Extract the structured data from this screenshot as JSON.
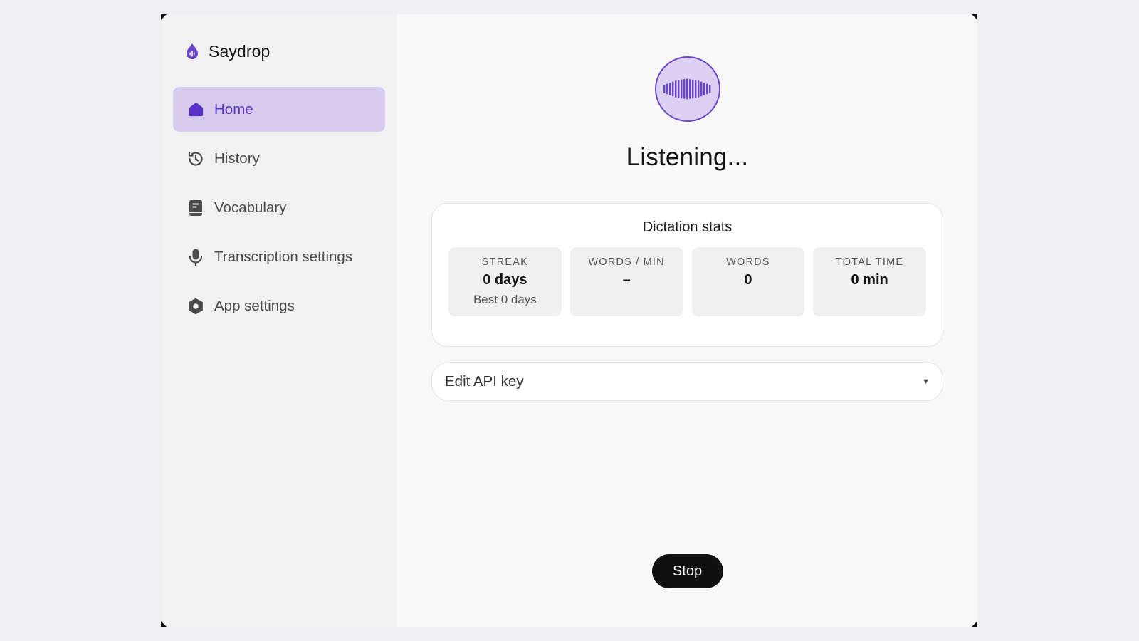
{
  "app": {
    "name": "Saydrop",
    "accent_color": "#6a45cc"
  },
  "sidebar": {
    "items": [
      {
        "label": "Home",
        "icon": "home-icon",
        "active": true
      },
      {
        "label": "History",
        "icon": "history-icon",
        "active": false
      },
      {
        "label": "Vocabulary",
        "icon": "book-icon",
        "active": false
      },
      {
        "label": "Transcription settings",
        "icon": "microphone-icon",
        "active": false
      },
      {
        "label": "App settings",
        "icon": "gear-icon",
        "active": false
      }
    ]
  },
  "main": {
    "status": "Listening...",
    "stats": {
      "title": "Dictation stats",
      "tiles": [
        {
          "label": "STREAK",
          "value": "0 days",
          "sub": "Best 0 days"
        },
        {
          "label": "WORDS / MIN",
          "value": "–",
          "sub": ""
        },
        {
          "label": "WORDS",
          "value": "0",
          "sub": ""
        },
        {
          "label": "TOTAL TIME",
          "value": "0 min",
          "sub": ""
        }
      ]
    },
    "api_key": {
      "label": "Edit API key"
    },
    "stop_label": "Stop"
  }
}
